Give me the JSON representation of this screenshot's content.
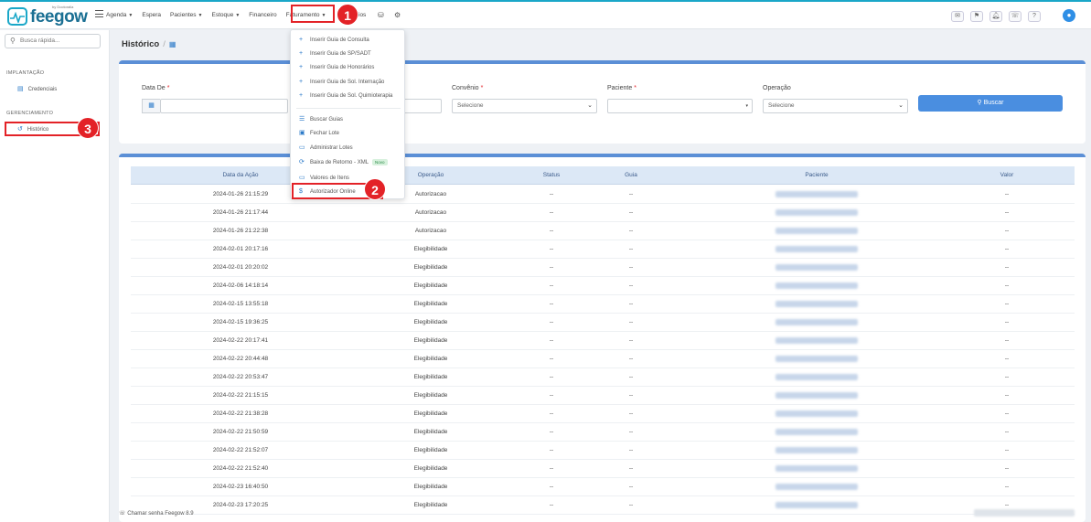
{
  "app": {
    "brand": "feegow",
    "brand_by": "by Doctoralia"
  },
  "nav": {
    "items": [
      {
        "label": "Agenda",
        "caret": true
      },
      {
        "label": "Espera",
        "caret": false
      },
      {
        "label": "Pacientes",
        "caret": true
      },
      {
        "label": "Estoque",
        "caret": true
      },
      {
        "label": "Financeiro",
        "caret": false
      },
      {
        "label": "Faturamento",
        "caret": true
      },
      {
        "label": "ios",
        "caret": false
      }
    ]
  },
  "sidebar": {
    "search_placeholder": "Busca rápida...",
    "sections": [
      {
        "title": "IMPLANTAÇÃO",
        "items": [
          {
            "label": "Credenciais",
            "icon": "document-icon"
          }
        ]
      },
      {
        "title": "GERENCIAMENTO",
        "items": [
          {
            "label": "Histórico",
            "icon": "history-icon"
          }
        ]
      }
    ]
  },
  "page": {
    "title": "Histórico",
    "sep": "/"
  },
  "filters": {
    "data_de": {
      "label": "Data De",
      "required": "*"
    },
    "convenio": {
      "label": "Convênio",
      "required": "*",
      "value": "Selecione"
    },
    "paciente": {
      "label": "Paciente",
      "required": "*"
    },
    "operacao": {
      "label": "Operação",
      "value": "Selecione"
    },
    "buscar_label": "Buscar"
  },
  "menu": {
    "items": [
      {
        "label": "Inserir Guia de Consulta",
        "icon": "plus-icon"
      },
      {
        "label": "Inserir Guia de SP/SADT",
        "icon": "plus-icon"
      },
      {
        "label": "Inserir Guia de Honorários",
        "icon": "plus-icon"
      },
      {
        "label": "Inserir Guia de Sol. Internação",
        "icon": "plus-icon"
      },
      {
        "label": "Inserir Guia de Sol. Quimioterapia",
        "icon": "plus-icon"
      },
      {
        "label": "Buscar Guias",
        "icon": "list-icon"
      },
      {
        "label": "Fechar Lote",
        "icon": "package-icon"
      },
      {
        "label": "Administrar Lotes",
        "icon": "folder-icon"
      },
      {
        "label": "Baixa de Retorno - XML",
        "icon": "sync-icon",
        "badge": "Novo"
      },
      {
        "label": "Valores de Itens",
        "icon": "card-icon"
      },
      {
        "label": "Autorizador Online",
        "icon": "dollar-icon"
      }
    ]
  },
  "table": {
    "headers": [
      "Data da Ação",
      "Operação",
      "Status",
      "Guia",
      "Paciente",
      "Valor"
    ],
    "rows": [
      {
        "date": "2024-01-26 21:15:29",
        "op": "Autorizacao",
        "status": "--",
        "guia": "--",
        "valor": "--"
      },
      {
        "date": "2024-01-26 21:17:44",
        "op": "Autorizacao",
        "status": "--",
        "guia": "--",
        "valor": "--"
      },
      {
        "date": "2024-01-26 21:22:38",
        "op": "Autorizacao",
        "status": "--",
        "guia": "--",
        "valor": "--"
      },
      {
        "date": "2024-02-01 20:17:16",
        "op": "Elegibilidade",
        "status": "--",
        "guia": "--",
        "valor": "--"
      },
      {
        "date": "2024-02-01 20:20:02",
        "op": "Elegibilidade",
        "status": "--",
        "guia": "--",
        "valor": "--"
      },
      {
        "date": "2024-02-06 14:18:14",
        "op": "Elegibilidade",
        "status": "--",
        "guia": "--",
        "valor": "--"
      },
      {
        "date": "2024-02-15 13:55:18",
        "op": "Elegibilidade",
        "status": "--",
        "guia": "--",
        "valor": "--"
      },
      {
        "date": "2024-02-15 19:36:25",
        "op": "Elegibilidade",
        "status": "--",
        "guia": "--",
        "valor": "--"
      },
      {
        "date": "2024-02-22 20:17:41",
        "op": "Elegibilidade",
        "status": "--",
        "guia": "--",
        "valor": "--"
      },
      {
        "date": "2024-02-22 20:44:48",
        "op": "Elegibilidade",
        "status": "--",
        "guia": "--",
        "valor": "--"
      },
      {
        "date": "2024-02-22 20:53:47",
        "op": "Elegibilidade",
        "status": "--",
        "guia": "--",
        "valor": "--"
      },
      {
        "date": "2024-02-22 21:15:15",
        "op": "Elegibilidade",
        "status": "--",
        "guia": "--",
        "valor": "--"
      },
      {
        "date": "2024-02-22 21:38:28",
        "op": "Elegibilidade",
        "status": "--",
        "guia": "--",
        "valor": "--"
      },
      {
        "date": "2024-02-22 21:50:59",
        "op": "Elegibilidade",
        "status": "--",
        "guia": "--",
        "valor": "--"
      },
      {
        "date": "2024-02-22 21:52:07",
        "op": "Elegibilidade",
        "status": "--",
        "guia": "--",
        "valor": "--"
      },
      {
        "date": "2024-02-22 21:52:40",
        "op": "Elegibilidade",
        "status": "--",
        "guia": "--",
        "valor": "--"
      },
      {
        "date": "2024-02-23 16:40:50",
        "op": "Elegibilidade",
        "status": "--",
        "guia": "--",
        "valor": "--"
      },
      {
        "date": "2024-02-23 17:20:25",
        "op": "Elegibilidade",
        "status": "--",
        "guia": "--",
        "valor": "--"
      }
    ]
  },
  "footer": {
    "chamar_senha": "Chamar senha",
    "version": "Feegow 8.9"
  },
  "callouts": [
    "1",
    "2",
    "3"
  ],
  "colors": {
    "accent": "#4a8ee0",
    "highlight": "#e32227",
    "brand": "#1aa7c8"
  }
}
